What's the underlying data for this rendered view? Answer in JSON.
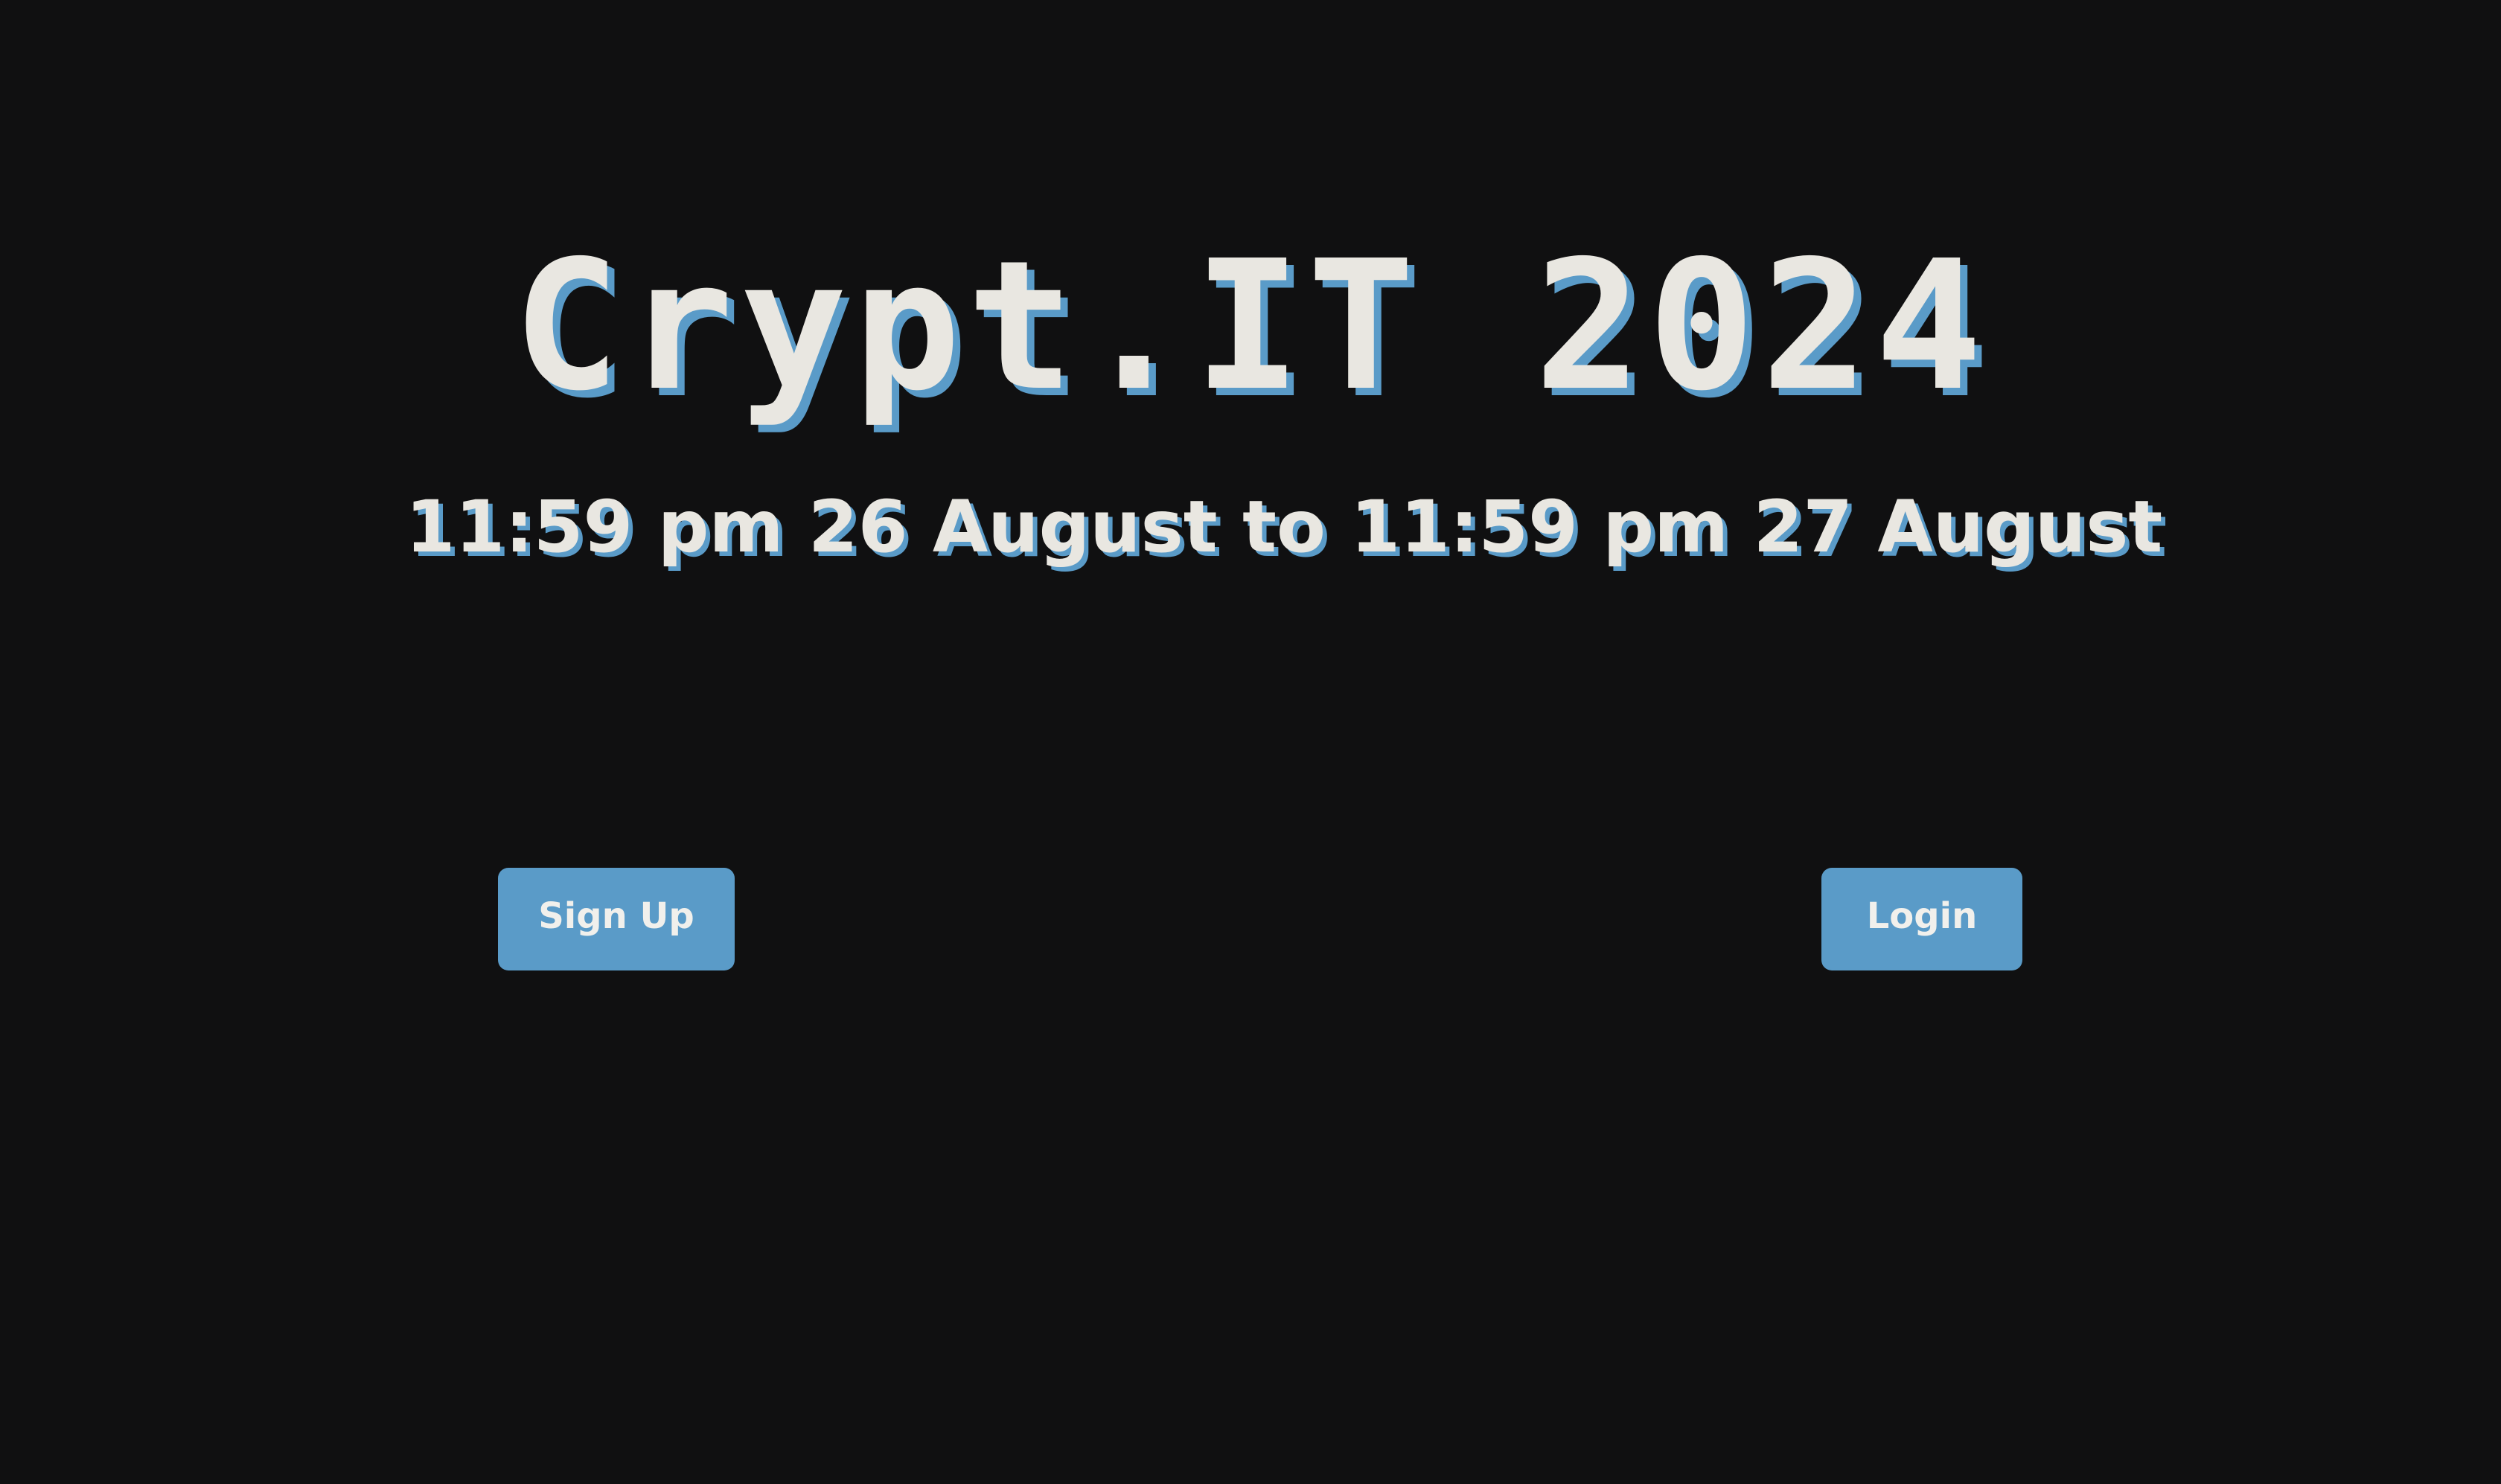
{
  "page": {
    "title": "Crypt.IT 2024",
    "schedule": "11:59 pm 26 August to 11:59 pm 27 August"
  },
  "actions": {
    "signup_label": "Sign Up",
    "login_label": "Login"
  },
  "colors": {
    "background": "#101011",
    "text": "#E9E7E1",
    "accent": "#5A9BC8"
  }
}
